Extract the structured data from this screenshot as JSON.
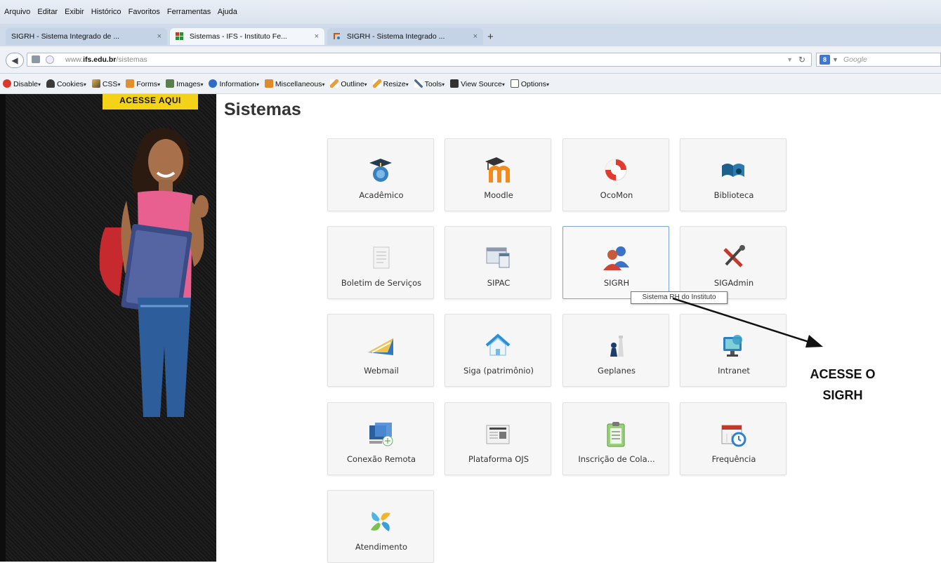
{
  "menu": [
    "Arquivo",
    "Editar",
    "Exibir",
    "Histórico",
    "Favoritos",
    "Ferramentas",
    "Ajuda"
  ],
  "tabs": [
    {
      "label": "SIGRH - Sistema Integrado de ...",
      "close": "×"
    },
    {
      "label": "Sistemas - IFS - Instituto Fe...",
      "close": "×"
    },
    {
      "label": "SIGRH - Sistema Integrado ...",
      "close": "×"
    }
  ],
  "newtab": "+",
  "url": {
    "prefix": "www.",
    "host": "ifs.edu.br",
    "path": "/sistemas"
  },
  "search": {
    "placeholder": "Google",
    "engine": "8"
  },
  "devtools": [
    "Disable",
    "Cookies",
    "CSS",
    "Forms",
    "Images",
    "Information",
    "Miscellaneous",
    "Outline",
    "Resize",
    "Tools",
    "View Source",
    "Options"
  ],
  "banner": {
    "cta": "ACESSE AQUI"
  },
  "page": {
    "title": "Sistemas"
  },
  "systems": [
    {
      "label": "Acadêmico",
      "icon": "academic-icon"
    },
    {
      "label": "Moodle",
      "icon": "moodle-icon"
    },
    {
      "label": "OcoMon",
      "icon": "lifebuoy-icon"
    },
    {
      "label": "Biblioteca",
      "icon": "library-icon"
    },
    {
      "label": "Boletim de Serviços",
      "icon": "document-icon"
    },
    {
      "label": "SIPAC",
      "icon": "windows-icon"
    },
    {
      "label": "SIGRH",
      "icon": "users-icon"
    },
    {
      "label": "SIGAdmin",
      "icon": "tools-icon"
    },
    {
      "label": "Webmail",
      "icon": "mail-icon"
    },
    {
      "label": "Siga (patrimônio)",
      "icon": "home-icon"
    },
    {
      "label": "Geplanes",
      "icon": "chess-icon"
    },
    {
      "label": "Intranet",
      "icon": "monitor-icon"
    },
    {
      "label": "Conexão Remota",
      "icon": "remote-desktop-icon"
    },
    {
      "label": "Plataforma OJS",
      "icon": "newspaper-icon"
    },
    {
      "label": "Inscrição de Cola...",
      "icon": "clipboard-icon"
    },
    {
      "label": "Frequência",
      "icon": "calendar-clock-icon"
    },
    {
      "label": "Atendimento",
      "icon": "pinwheel-icon"
    }
  ],
  "tooltip": "Sistema RH do Instituto",
  "callout": {
    "line1": "ACESSE O",
    "line2": "SIGRH"
  }
}
